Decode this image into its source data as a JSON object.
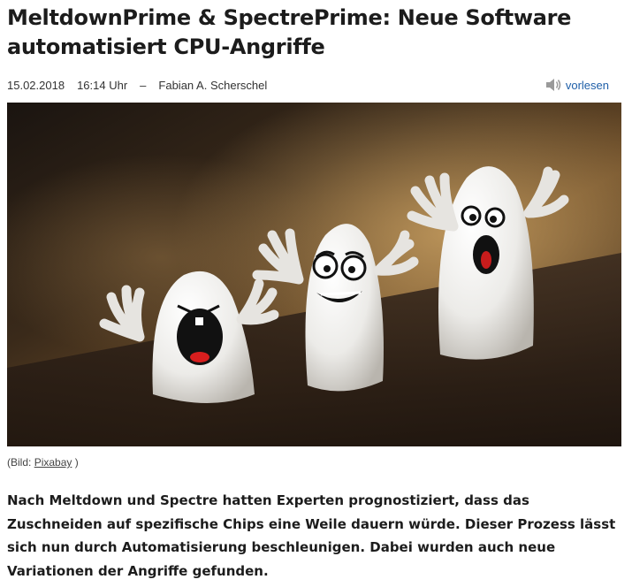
{
  "article": {
    "headline": "MeltdownPrime & SpectrePrime: Neue Software automatisiert CPU-Angriffe",
    "date": "15.02.2018",
    "time": "16:14 Uhr",
    "separator": "–",
    "author": "Fabian A. Scherschel",
    "read_aloud_label": "vorlesen",
    "read_aloud_icon": "speaker-icon",
    "image_caption_prefix": "(Bild: ",
    "image_caption_link": "Pixabay",
    "image_caption_suffix": " )",
    "lead": "Nach Meltdown und Spectre hatten Experten prognostiziert, dass das Zuschneiden auf spezifische Chips eine Weile dauern würde. Dieser Prozess lässt sich nun durch Automatisierung beschleunigen. Dabei wurden auch neue Variationen der Angriffe gefunden."
  },
  "colors": {
    "link": "#1f5fa8",
    "text": "#1c1c1c"
  }
}
